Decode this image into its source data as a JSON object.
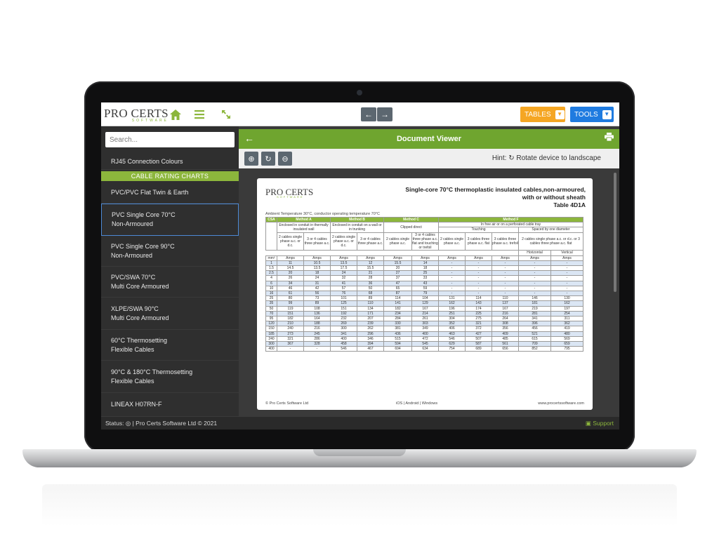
{
  "app": {
    "logo_main": "PRO CERTS",
    "logo_sub": "SOFTWARE"
  },
  "topbar": {
    "tables_label": "TABLES",
    "tools_label": "TOOLS",
    "colors": {
      "tables": "#f5a623",
      "tools": "#1f7be0",
      "accent": "#8cb63c"
    }
  },
  "sidebar": {
    "search_placeholder": "Search...",
    "first_item": "RJ45 Connection Colours",
    "section_header": "CABLE RATING CHARTS",
    "items": [
      {
        "line1": "PVC/PVC Flat Twin & Earth",
        "line2": ""
      },
      {
        "line1": "PVC Single Core 70°C",
        "line2": "Non-Armoured"
      },
      {
        "line1": "PVC Single Core 90°C",
        "line2": "Non-Armoured"
      },
      {
        "line1": "PVC/SWA 70°C",
        "line2": "Multi Core Armoured"
      },
      {
        "line1": "XLPE/SWA 90°C",
        "line2": "Multi Core Armoured"
      },
      {
        "line1": "60°C Thermosetting",
        "line2": "Flexible Cables"
      },
      {
        "line1": "90°C & 180°C Thermosetting",
        "line2": "Flexible Cables"
      },
      {
        "line1": "LINEAX H07RN-F",
        "line2": ""
      }
    ],
    "active_index": 1
  },
  "viewer": {
    "title": "Document Viewer",
    "hint": "Hint: ↻ Rotate device to landscape"
  },
  "document": {
    "logo": "PRO CERTS",
    "logo_sub": "SOFTWARE",
    "title_line1": "Single-core 70°C thermoplastic insulated cables,non-armoured,",
    "title_line2": "with or without sheath",
    "title_line3": "Table 4D1A",
    "conditions": "Ambient Temperature 30°C, conductor operating temperature 70°C",
    "methods": [
      "CSA",
      "Method A",
      "Method B",
      "Method C",
      "Method F"
    ],
    "method_desc": {
      "a": "Enclosed in conduit in thermally insulated wall",
      "b": "Enclosed in conduit on a wall or in trunking",
      "c": "Clipped direct",
      "f": "In free air or on a perforated cable tray",
      "touching": "Touching",
      "spaced": "Spaced by one diameter",
      "spaced_desc": "2 cables single phase a.c. or d.c. or 3 cables three phase a.c. flat",
      "horizontal": "Horizontal",
      "vertical": "Vertical"
    },
    "col_desc": [
      "2 cables single phase a.c. or d.c.",
      "3 or 4 cables three phase a.c.",
      "2 cables single phase a.c. or d.c.",
      "3 or 4 cables three phase a.c.",
      "2 cables single phase a.c.",
      "3 or 4 cables three phase a.c. flat and touching or trefoil",
      "2 cables single phase a.c.",
      "3 cables three phase a.c. flat",
      "3 cables three phase a.c. trefoil"
    ],
    "units": [
      "mm²",
      "Amps",
      "Amps",
      "Amps",
      "Amps",
      "Amps",
      "Amps",
      "Amps",
      "Amps",
      "Amps",
      "Amps",
      "Amps"
    ],
    "rows": [
      [
        "1",
        "11",
        "10.5",
        "13.5",
        "12",
        "15.5",
        "14",
        "-",
        "-",
        "-",
        "-",
        "-"
      ],
      [
        "1.5",
        "14.5",
        "13.5",
        "17.5",
        "15.5",
        "20",
        "18",
        "-",
        "-",
        "-",
        "-",
        "-"
      ],
      [
        "2.5",
        "20",
        "18",
        "24",
        "21",
        "27",
        "25",
        "-",
        "-",
        "-",
        "-",
        "-"
      ],
      [
        "4",
        "26",
        "24",
        "32",
        "28",
        "37",
        "33",
        "-",
        "-",
        "-",
        "-",
        "-"
      ],
      [
        "6",
        "34",
        "31",
        "41",
        "36",
        "47",
        "43",
        "-",
        "-",
        "-",
        "-",
        "-"
      ],
      [
        "10",
        "46",
        "42",
        "57",
        "50",
        "65",
        "59",
        "-",
        "-",
        "-",
        "-",
        "-"
      ],
      [
        "16",
        "61",
        "56",
        "76",
        "68",
        "87",
        "79",
        "-",
        "-",
        "-",
        "-",
        "-"
      ],
      [
        "25",
        "80",
        "73",
        "101",
        "89",
        "114",
        "104",
        "131",
        "114",
        "110",
        "146",
        "130"
      ],
      [
        "35",
        "99",
        "89",
        "125",
        "110",
        "141",
        "129",
        "162",
        "143",
        "137",
        "181",
        "162"
      ],
      [
        "50",
        "119",
        "108",
        "151",
        "134",
        "182",
        "167",
        "196",
        "174",
        "167",
        "219",
        "197"
      ],
      [
        "70",
        "151",
        "136",
        "192",
        "171",
        "234",
        "214",
        "251",
        "225",
        "216",
        "281",
        "254"
      ],
      [
        "95",
        "182",
        "164",
        "232",
        "207",
        "284",
        "261",
        "304",
        "275",
        "264",
        "341",
        "311"
      ],
      [
        "120",
        "210",
        "188",
        "269",
        "239",
        "330",
        "303",
        "352",
        "321",
        "308",
        "396",
        "362"
      ],
      [
        "150",
        "240",
        "216",
        "300",
        "262",
        "381",
        "349",
        "406",
        "372",
        "356",
        "456",
        "419"
      ],
      [
        "185",
        "273",
        "245",
        "341",
        "296",
        "436",
        "400",
        "463",
        "427",
        "409",
        "521",
        "480"
      ],
      [
        "240",
        "321",
        "286",
        "400",
        "346",
        "515",
        "472",
        "546",
        "507",
        "485",
        "615",
        "569"
      ],
      [
        "300",
        "367",
        "328",
        "458",
        "394",
        "594",
        "545",
        "629",
        "587",
        "561",
        "709",
        "659"
      ],
      [
        "400",
        "-",
        "-",
        "546",
        "467",
        "694",
        "634",
        "754",
        "689",
        "656",
        "852",
        "795"
      ]
    ],
    "footer_left": "© Pro Certs Software Ltd",
    "footer_mid": "iOS | Android | Windows",
    "footer_right": "www.procertssoftware.com"
  },
  "statusbar": {
    "left": "Status: ◎ | Pro Certs Software Ltd © 2021",
    "right": "▣ Support"
  }
}
